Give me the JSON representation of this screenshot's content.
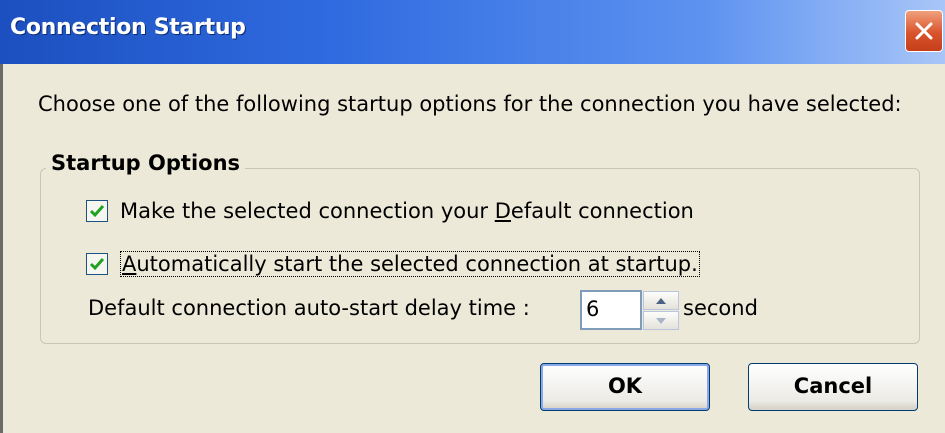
{
  "window": {
    "title": "Connection Startup"
  },
  "intro_text": "Choose one of the following startup options for the connection you have selected:",
  "startup_options": {
    "legend": "Startup Options",
    "default_connection": {
      "label_before": "Make the selected connection your ",
      "label_underlined": "D",
      "label_after": "efault connection",
      "checked": true
    },
    "auto_start": {
      "label_underlined": "A",
      "label_after": "utomatically start the selected connection at startup.",
      "checked": true
    },
    "delay": {
      "label": "Default connection auto-start delay time :",
      "value": "6",
      "unit": "second"
    }
  },
  "buttons": {
    "ok": "OK",
    "cancel": "Cancel"
  },
  "colors": {
    "title_bar": "#2f6be0",
    "dialog_background": "#ece9d8",
    "checkmark": "#21a121",
    "close_button": "#d9542c"
  }
}
